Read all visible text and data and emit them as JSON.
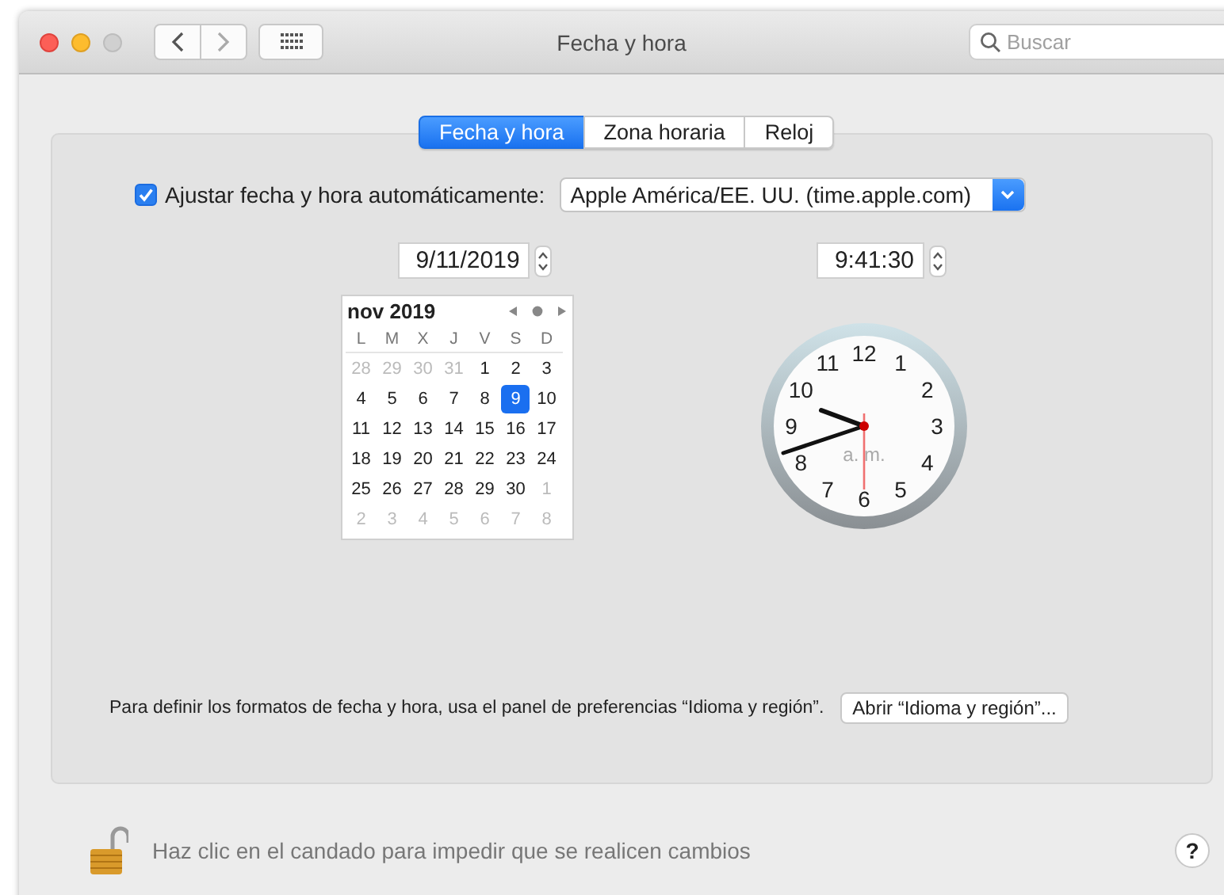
{
  "window": {
    "title": "Fecha y hora"
  },
  "search": {
    "placeholder": "Buscar"
  },
  "tabs": [
    {
      "label": "Fecha y hora",
      "selected": true
    },
    {
      "label": "Zona horaria",
      "selected": false
    },
    {
      "label": "Reloj",
      "selected": false
    }
  ],
  "auto_set": {
    "label": "Ajustar fecha y hora automáticamente:",
    "checked": true,
    "server": "Apple América/EE. UU. (time.apple.com)"
  },
  "date_field": {
    "value": "9/11/2019"
  },
  "time_field": {
    "value": "9:41:30"
  },
  "calendar": {
    "month": "nov 2019",
    "weekdays": [
      "L",
      "M",
      "X",
      "J",
      "V",
      "S",
      "D"
    ],
    "weeks": [
      [
        {
          "day": "28",
          "muted": true,
          "selected": false
        },
        {
          "day": "29",
          "muted": true,
          "selected": false
        },
        {
          "day": "30",
          "muted": true,
          "selected": false
        },
        {
          "day": "31",
          "muted": true,
          "selected": false
        },
        {
          "day": "1",
          "muted": false,
          "selected": false
        },
        {
          "day": "2",
          "muted": false,
          "selected": false
        },
        {
          "day": "3",
          "muted": false,
          "selected": false
        }
      ],
      [
        {
          "day": "4",
          "muted": false,
          "selected": false
        },
        {
          "day": "5",
          "muted": false,
          "selected": false
        },
        {
          "day": "6",
          "muted": false,
          "selected": false
        },
        {
          "day": "7",
          "muted": false,
          "selected": false
        },
        {
          "day": "8",
          "muted": false,
          "selected": false
        },
        {
          "day": "9",
          "muted": false,
          "selected": true
        },
        {
          "day": "10",
          "muted": false,
          "selected": false
        }
      ],
      [
        {
          "day": "11",
          "muted": false,
          "selected": false
        },
        {
          "day": "12",
          "muted": false,
          "selected": false
        },
        {
          "day": "13",
          "muted": false,
          "selected": false
        },
        {
          "day": "14",
          "muted": false,
          "selected": false
        },
        {
          "day": "15",
          "muted": false,
          "selected": false
        },
        {
          "day": "16",
          "muted": false,
          "selected": false
        },
        {
          "day": "17",
          "muted": false,
          "selected": false
        }
      ],
      [
        {
          "day": "18",
          "muted": false,
          "selected": false
        },
        {
          "day": "19",
          "muted": false,
          "selected": false
        },
        {
          "day": "20",
          "muted": false,
          "selected": false
        },
        {
          "day": "21",
          "muted": false,
          "selected": false
        },
        {
          "day": "22",
          "muted": false,
          "selected": false
        },
        {
          "day": "23",
          "muted": false,
          "selected": false
        },
        {
          "day": "24",
          "muted": false,
          "selected": false
        }
      ],
      [
        {
          "day": "25",
          "muted": false,
          "selected": false
        },
        {
          "day": "26",
          "muted": false,
          "selected": false
        },
        {
          "day": "27",
          "muted": false,
          "selected": false
        },
        {
          "day": "28",
          "muted": false,
          "selected": false
        },
        {
          "day": "29",
          "muted": false,
          "selected": false
        },
        {
          "day": "30",
          "muted": false,
          "selected": false
        },
        {
          "day": "1",
          "muted": true,
          "selected": false
        }
      ],
      [
        {
          "day": "2",
          "muted": true,
          "selected": false
        },
        {
          "day": "3",
          "muted": true,
          "selected": false
        },
        {
          "day": "4",
          "muted": true,
          "selected": false
        },
        {
          "day": "5",
          "muted": true,
          "selected": false
        },
        {
          "day": "6",
          "muted": true,
          "selected": false
        },
        {
          "day": "7",
          "muted": true,
          "selected": false
        },
        {
          "day": "8",
          "muted": true,
          "selected": false
        }
      ]
    ]
  },
  "clock": {
    "numbers": [
      "11",
      "12",
      "1",
      "10",
      "2",
      "9",
      "3",
      "8",
      "4",
      "7",
      "6",
      "5"
    ],
    "period": "a. m."
  },
  "formats": {
    "text": "Para definir los formatos de fecha y hora, usa el panel de preferencias “Idioma y región”.",
    "button": "Abrir “Idioma y región”..."
  },
  "footer": {
    "lock_text": "Haz clic en el candado para impedir que se realicen cambios",
    "locked": false,
    "help": "?"
  }
}
